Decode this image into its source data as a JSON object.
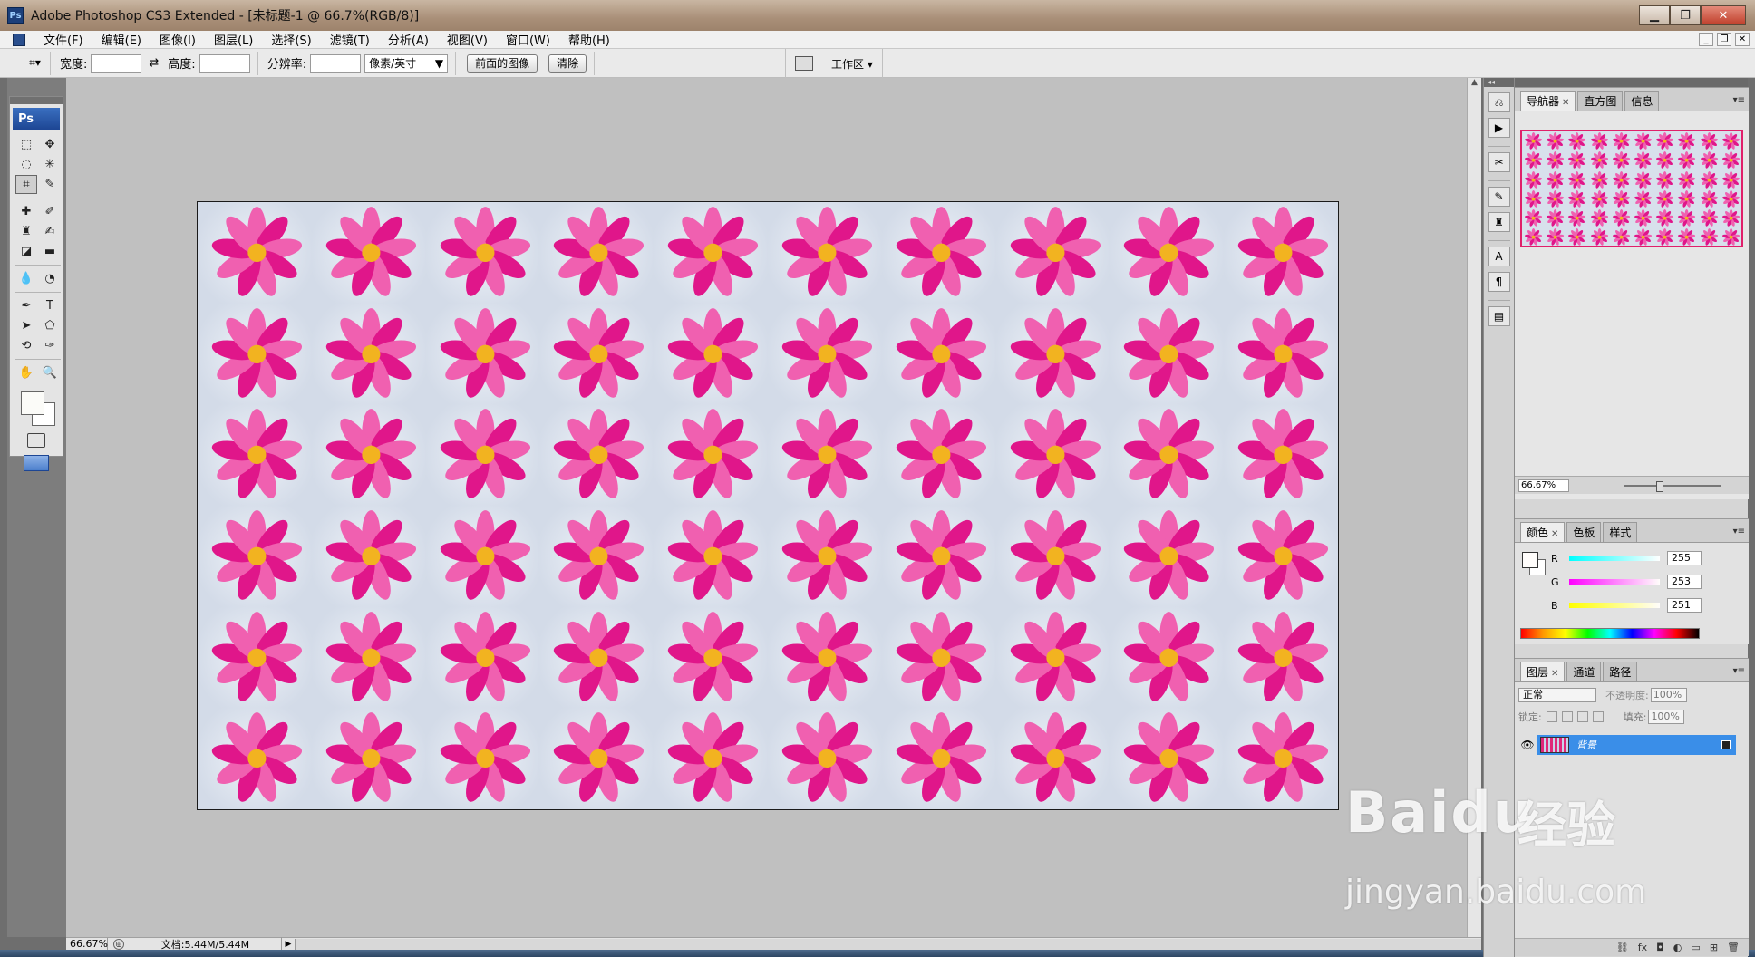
{
  "window": {
    "title": "Adobe Photoshop CS3 Extended - [未标题-1 @ 66.7%(RGB/8)]",
    "logo": "Ps",
    "controls": [
      "minimize-icon",
      "restore-icon",
      "close-icon"
    ]
  },
  "menubar": {
    "items": [
      "文件(F)",
      "编辑(E)",
      "图像(I)",
      "图层(L)",
      "选择(S)",
      "滤镜(T)",
      "分析(A)",
      "视图(V)",
      "窗口(W)",
      "帮助(H)"
    ]
  },
  "options": {
    "width_label": "宽度:",
    "width_value": "",
    "height_label": "高度:",
    "height_value": "",
    "swap_icon": "swap-arrows-icon",
    "resolution_label": "分辨率:",
    "resolution_value": "",
    "unit_select": "像素/英寸",
    "front_image_button": "前面的图像",
    "clear_button": "清除",
    "workspace_label": "工作区"
  },
  "toolbox": {
    "logo": "Ps",
    "tools": [
      {
        "name": "marquee-icon",
        "glyph": "⬚"
      },
      {
        "name": "move-icon",
        "glyph": "✥"
      },
      {
        "name": "lasso-icon",
        "glyph": "◌"
      },
      {
        "name": "magic-wand-icon",
        "glyph": "✳"
      },
      {
        "name": "crop-icon",
        "glyph": "⌗",
        "active": true
      },
      {
        "name": "slice-icon",
        "glyph": "✎"
      },
      {
        "name": "healing-brush-icon",
        "glyph": "✚"
      },
      {
        "name": "brush-icon",
        "glyph": "✐"
      },
      {
        "name": "stamp-icon",
        "glyph": "♜"
      },
      {
        "name": "history-brush-icon",
        "glyph": "✍"
      },
      {
        "name": "eraser-icon",
        "glyph": "◪"
      },
      {
        "name": "gradient-icon",
        "glyph": "▬"
      },
      {
        "name": "blur-icon",
        "glyph": "💧"
      },
      {
        "name": "dodge-icon",
        "glyph": "◔"
      },
      {
        "name": "pen-icon",
        "glyph": "✒"
      },
      {
        "name": "type-icon",
        "glyph": "T"
      },
      {
        "name": "path-select-icon",
        "glyph": "➤"
      },
      {
        "name": "shape-icon",
        "glyph": "⬠"
      },
      {
        "name": "3d-rotate-icon",
        "glyph": "⟲"
      },
      {
        "name": "eyedropper-icon",
        "glyph": "✑"
      },
      {
        "name": "hand-icon",
        "glyph": "✋"
      },
      {
        "name": "zoom-icon",
        "glyph": "🔍"
      }
    ]
  },
  "canvas": {
    "rows": 6,
    "cols": 10,
    "tile_subject": "pink-flower"
  },
  "colors": {
    "petal": "#e0168a",
    "petal_light": "#f060b0",
    "center": "#f2b320",
    "accent": "#3a8ee8"
  },
  "status": {
    "zoom": "66.67%",
    "doc_size": "文档:5.44M/5.44M"
  },
  "dock": {
    "icons": [
      "history-icon",
      "actions-icon",
      "tool-presets-icon",
      "brushes-icon",
      "clone-source-icon",
      "character-icon",
      "paragraph-icon",
      "layer-comps-icon"
    ]
  },
  "navigator": {
    "tabs": [
      "导航器",
      "直方图",
      "信息"
    ],
    "zoom": "66.67%"
  },
  "color_panel": {
    "tabs": [
      "颜色",
      "色板",
      "样式"
    ],
    "channels": [
      {
        "label": "R",
        "value": "255"
      },
      {
        "label": "G",
        "value": "253"
      },
      {
        "label": "B",
        "value": "251"
      }
    ]
  },
  "layers_panel": {
    "tabs": [
      "图层",
      "通道",
      "路径"
    ],
    "blend_mode": "正常",
    "opacity_label": "不透明度:",
    "opacity_value": "100%",
    "lock_label": "锁定:",
    "fill_label": "填充:",
    "fill_value": "100%",
    "layers": [
      {
        "name": "背景",
        "visible": true,
        "locked": true
      }
    ]
  },
  "watermark": {
    "brand": "Baidu",
    "brand_cn": "经验",
    "url": "jingyan.baidu.com"
  }
}
